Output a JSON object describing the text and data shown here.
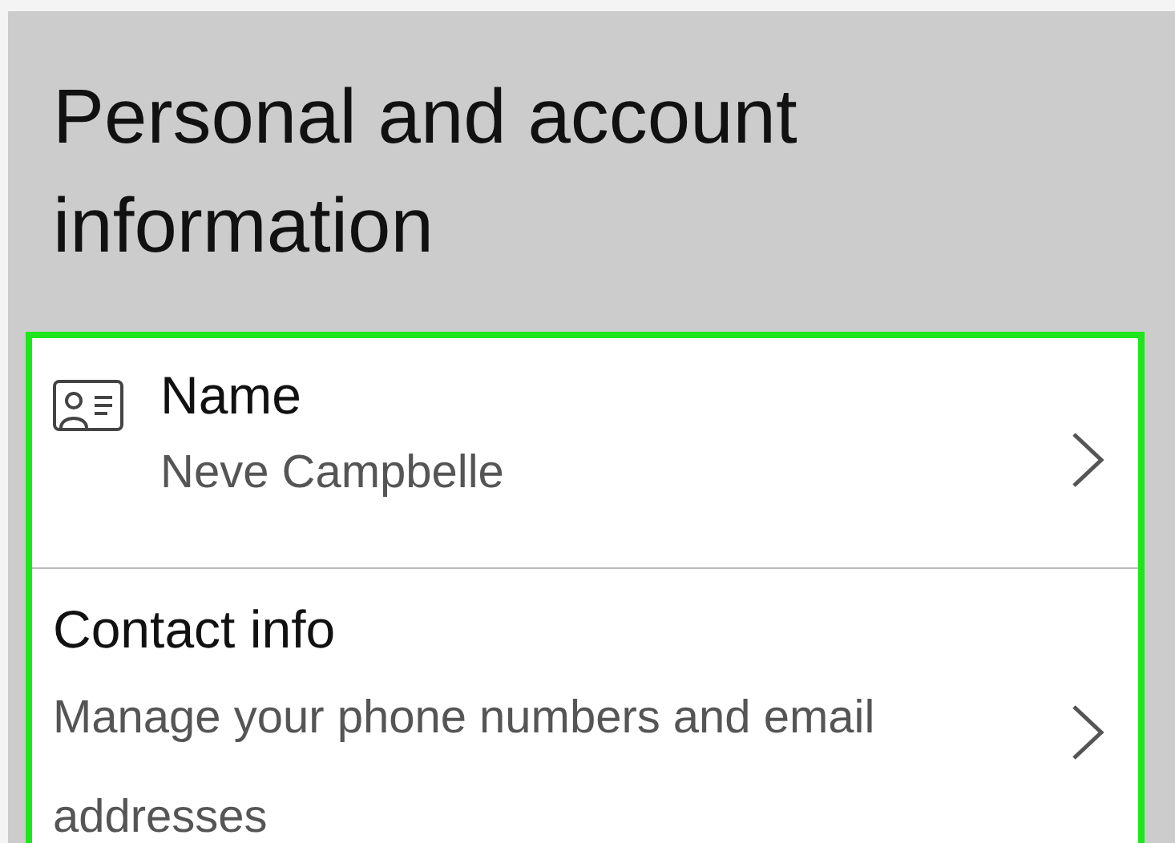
{
  "header": {
    "title": "Personal and account information"
  },
  "items": [
    {
      "kind": "with-icon",
      "title": "Name",
      "detail": "Neve Campbelle"
    },
    {
      "kind": "plain",
      "title": "Contact info",
      "detail": "Manage your phone numbers and email addresses"
    }
  ]
}
